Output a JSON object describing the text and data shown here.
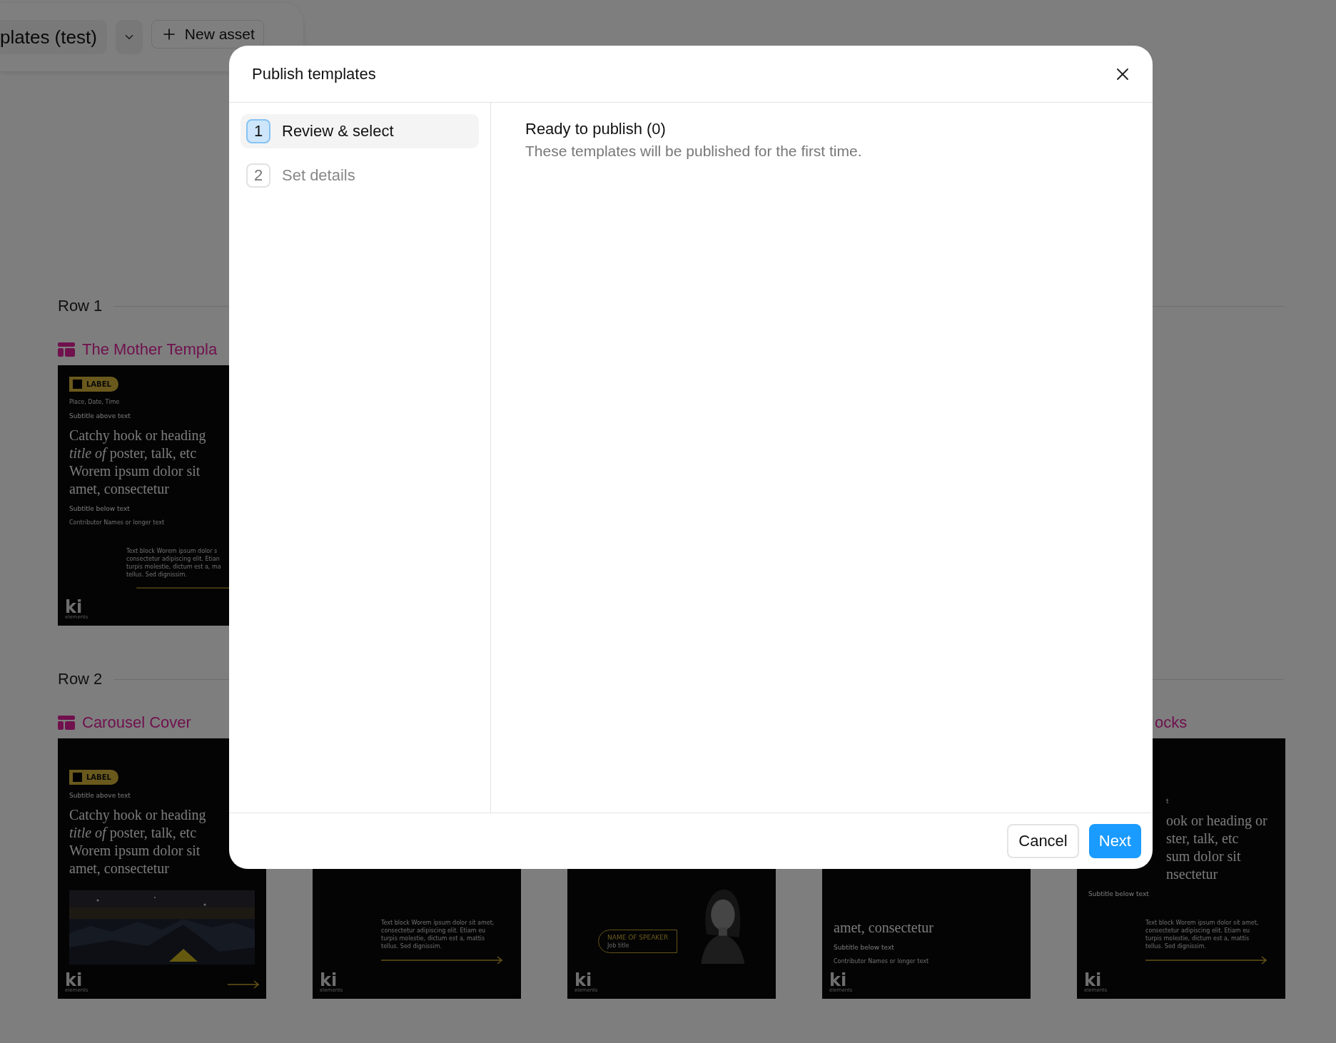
{
  "toolbar": {
    "title": "plates (test)",
    "new_button": "New asset"
  },
  "rows": [
    {
      "title": "Row 1",
      "templates": [
        {
          "title": {
            "text": "The Mother Templa",
            "kind": "full"
          },
          "card": {
            "logo": "ki",
            "logo_sub": "elements",
            "footer_arrow": false,
            "blocks": [
              {
                "kind": "label",
                "text": "LABEL"
              },
              {
                "kind": "caption",
                "text": "Place, Date, Time"
              },
              {
                "kind": "subtitle",
                "text": "Subtitle above text"
              },
              {
                "kind": "heading",
                "lines": [
                  "Catchy hook or heading",
                  "*title of* poster, talk, etc",
                  "Worem ipsum dolor sit",
                  "amet, consectetur"
                ]
              },
              {
                "kind": "subtitle",
                "text": "Subtitle below text"
              },
              {
                "kind": "caption",
                "text": "Contributor Names or longer text"
              },
              {
                "kind": "textblock",
                "lines": [
                  "Text block Worem ipsum dolor s",
                  "consectetur adipiscing elit. Etian",
                  "turpis molestie, dictum est a, ma",
                  "tellus. Sed dignissim."
                ]
              },
              {
                "kind": "arrow"
              }
            ]
          }
        }
      ]
    },
    {
      "title": "Row 2",
      "templates": [
        {
          "title": {
            "text": "Carousel Cover",
            "kind": "full"
          },
          "card": {
            "logo": "ki",
            "logo_sub": "elements",
            "footer_arrow": true,
            "blocks": [
              {
                "kind": "label",
                "text": "LABEL"
              },
              {
                "kind": "subtitle",
                "text": "Subtitle above text"
              },
              {
                "kind": "heading",
                "lines": [
                  "Catchy hook or heading",
                  "*title of* poster, talk, etc",
                  "Worem ipsum dolor sit",
                  "amet, consectetur"
                ]
              },
              {
                "kind": "picture"
              }
            ]
          }
        },
        {
          "card": {
            "logo": "ki",
            "logo_sub": "elements",
            "footer_arrow": false,
            "blocks": [
              {
                "kind": "textblock",
                "lines": [
                  "Text block Worem ipsum dolor sit amet,",
                  "consectetur adipiscing elit. Etiam eu",
                  "turpis molestie, dictum est a, mattis",
                  "tellus. Sed dignissim."
                ]
              },
              {
                "kind": "arrow"
              }
            ]
          }
        },
        {
          "card": {
            "logo": "ki",
            "logo_sub": "elements",
            "footer_arrow": false,
            "blocks": [
              {
                "kind": "speaker",
                "name": "NAME OF SPEAKER",
                "role": "Job title"
              }
            ]
          }
        },
        {
          "card": {
            "logo": "ki",
            "logo_sub": "elements",
            "footer_arrow": false,
            "blocks": [
              {
                "kind": "heading",
                "lines": [
                  "amet, consectetur"
                ]
              },
              {
                "kind": "subtitle",
                "text": "Subtitle below text"
              },
              {
                "kind": "caption",
                "text": "Contributor Names or longer text"
              }
            ]
          }
        },
        {
          "title": {
            "text": "ocks",
            "kind": "clipped"
          },
          "card": {
            "logo": "ki",
            "logo_sub": "elements",
            "footer_arrow": false,
            "blocks": [
              {
                "kind": "subtitle_clipped",
                "text": "t"
              },
              {
                "kind": "heading_clipped",
                "lines": [
                  "ook or heading or",
                  "ster, talk, etc",
                  "sum dolor sit",
                  "nsectetur"
                ]
              },
              {
                "kind": "subtitle",
                "text": "Subtitle below text"
              },
              {
                "kind": "textblock",
                "lines": [
                  "Text block Worem ipsum dolor sit amet,",
                  "consectetur adipiscing elit. Etiam eu",
                  "turpis molestie, dictum est a, mattis",
                  "tellus. Sed dignissim."
                ]
              },
              {
                "kind": "arrow"
              }
            ]
          }
        }
      ]
    }
  ],
  "modal": {
    "title": "Publish templates",
    "steps": [
      {
        "number": "1",
        "label": "Review & select",
        "selected": true
      },
      {
        "number": "2",
        "label": "Set details",
        "selected": false
      }
    ],
    "section_title": "Ready to publish (0)",
    "section_text": "These templates will be published for the first time.",
    "buttons": [
      {
        "label": "Cancel",
        "kind": "secondary"
      },
      {
        "label": "Next",
        "kind": "primary"
      }
    ]
  }
}
